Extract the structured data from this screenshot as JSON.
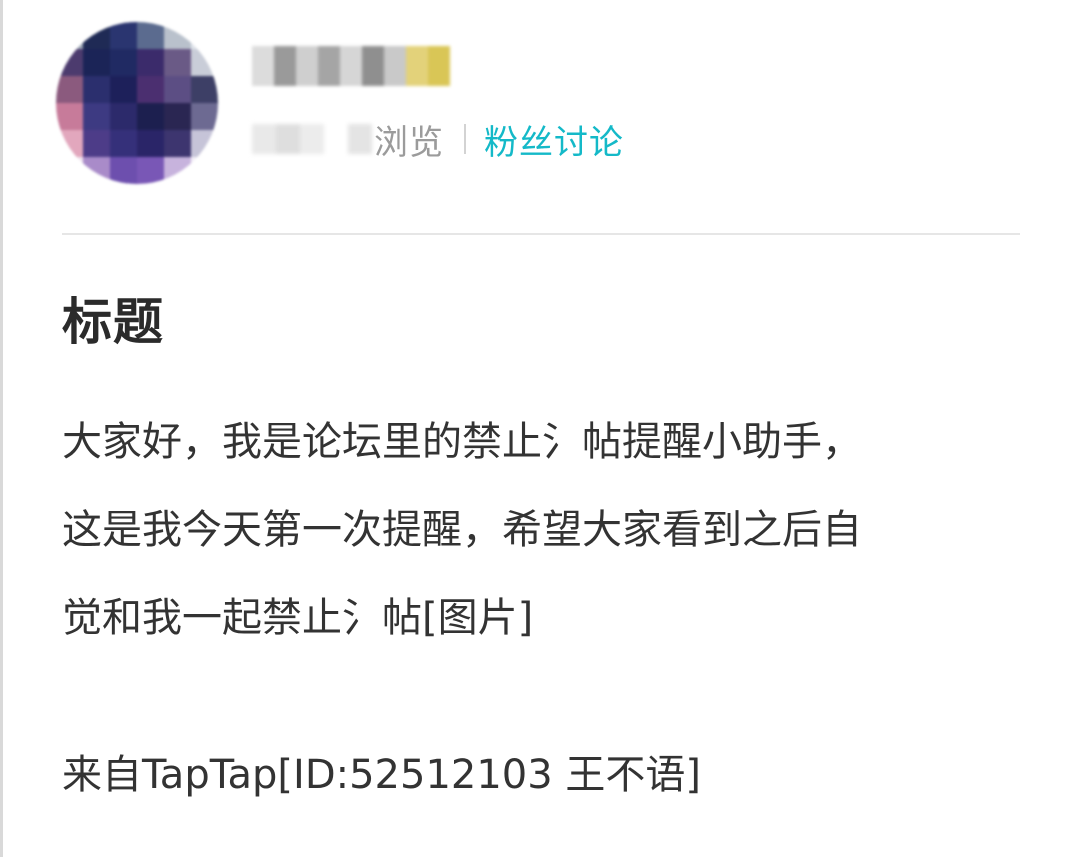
{
  "post_header": {
    "meta_views_label": "浏览",
    "meta_fans_link": "粉丝讨论"
  },
  "post": {
    "title": "标题",
    "body_lines": [
      "大家好，我是论坛里的禁止氵帖提醒小助手，",
      "这是我今天第一次提醒，希望大家看到之后自",
      "觉和我一起禁止氵帖[图片]"
    ],
    "source": "来自TapTap[ID:52512103 王不语]"
  },
  "colors": {
    "accent": "#14b9c8",
    "muted_text": "#9b9b9b",
    "body_text": "#333333",
    "title_text": "#2b2b2b",
    "divider": "#e6e6e6"
  }
}
